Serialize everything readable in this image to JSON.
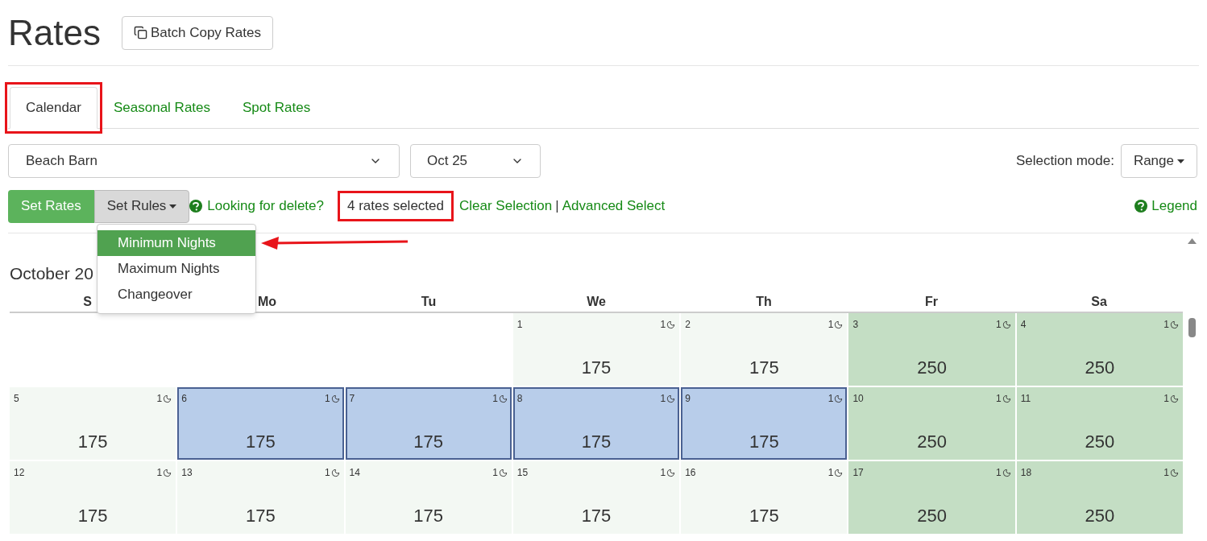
{
  "title": "Rates",
  "batch_button": "Batch Copy Rates",
  "tabs": [
    {
      "label": "Calendar",
      "selected": true,
      "highlighted": true
    },
    {
      "label": "Seasonal Rates",
      "selected": false,
      "highlighted": false
    },
    {
      "label": "Spot Rates",
      "selected": false,
      "highlighted": false
    }
  ],
  "property_select": {
    "value": "Beach Barn"
  },
  "month_select": {
    "value": "Oct 25"
  },
  "selection_mode": {
    "label": "Selection mode:",
    "value": "Range"
  },
  "set_rates_button": "Set Rates",
  "set_rules_button": {
    "label": "Set Rules",
    "expanded": true
  },
  "rules_menu": [
    {
      "label": "Minimum Nights",
      "selected": true,
      "pointed": true
    },
    {
      "label": "Maximum Nights",
      "selected": false,
      "pointed": false
    },
    {
      "label": "Changeover",
      "selected": false,
      "pointed": false
    }
  ],
  "delete_help": "Looking for delete?",
  "selection_count": {
    "text": "4 rates selected",
    "highlighted": true
  },
  "clear_selection": "Clear Selection",
  "separator": "|",
  "advanced_select": "Advanced Select",
  "legend": "Legend",
  "month_heading": "October 20",
  "weekdays": [
    "S",
    "Mo",
    "Tu",
    "We",
    "Th",
    "Fr",
    "Sa"
  ],
  "weeks": [
    [
      {
        "kind": "empty"
      },
      {
        "kind": "empty"
      },
      {
        "kind": "empty"
      },
      {
        "kind": "weekday",
        "day": "1",
        "nights": "1",
        "rate": "175",
        "selected": false
      },
      {
        "kind": "weekday",
        "day": "2",
        "nights": "1",
        "rate": "175",
        "selected": false
      },
      {
        "kind": "weekend",
        "day": "3",
        "nights": "1",
        "rate": "250",
        "selected": false
      },
      {
        "kind": "weekend",
        "day": "4",
        "nights": "1",
        "rate": "250",
        "selected": false
      }
    ],
    [
      {
        "kind": "weekday",
        "day": "5",
        "nights": "1",
        "rate": "175",
        "selected": false
      },
      {
        "kind": "weekday",
        "day": "6",
        "nights": "1",
        "rate": "175",
        "selected": true
      },
      {
        "kind": "weekday",
        "day": "7",
        "nights": "1",
        "rate": "175",
        "selected": true
      },
      {
        "kind": "weekday",
        "day": "8",
        "nights": "1",
        "rate": "175",
        "selected": true
      },
      {
        "kind": "weekday",
        "day": "9",
        "nights": "1",
        "rate": "175",
        "selected": true
      },
      {
        "kind": "weekend",
        "day": "10",
        "nights": "1",
        "rate": "250",
        "selected": false
      },
      {
        "kind": "weekend",
        "day": "11",
        "nights": "1",
        "rate": "250",
        "selected": false
      }
    ],
    [
      {
        "kind": "weekday",
        "day": "12",
        "nights": "1",
        "rate": "175",
        "selected": false
      },
      {
        "kind": "weekday",
        "day": "13",
        "nights": "1",
        "rate": "175",
        "selected": false
      },
      {
        "kind": "weekday",
        "day": "14",
        "nights": "1",
        "rate": "175",
        "selected": false
      },
      {
        "kind": "weekday",
        "day": "15",
        "nights": "1",
        "rate": "175",
        "selected": false
      },
      {
        "kind": "weekday",
        "day": "16",
        "nights": "1",
        "rate": "175",
        "selected": false
      },
      {
        "kind": "weekend",
        "day": "17",
        "nights": "1",
        "rate": "250",
        "selected": false
      },
      {
        "kind": "weekend",
        "day": "18",
        "nights": "1",
        "rate": "250",
        "selected": false
      }
    ]
  ]
}
